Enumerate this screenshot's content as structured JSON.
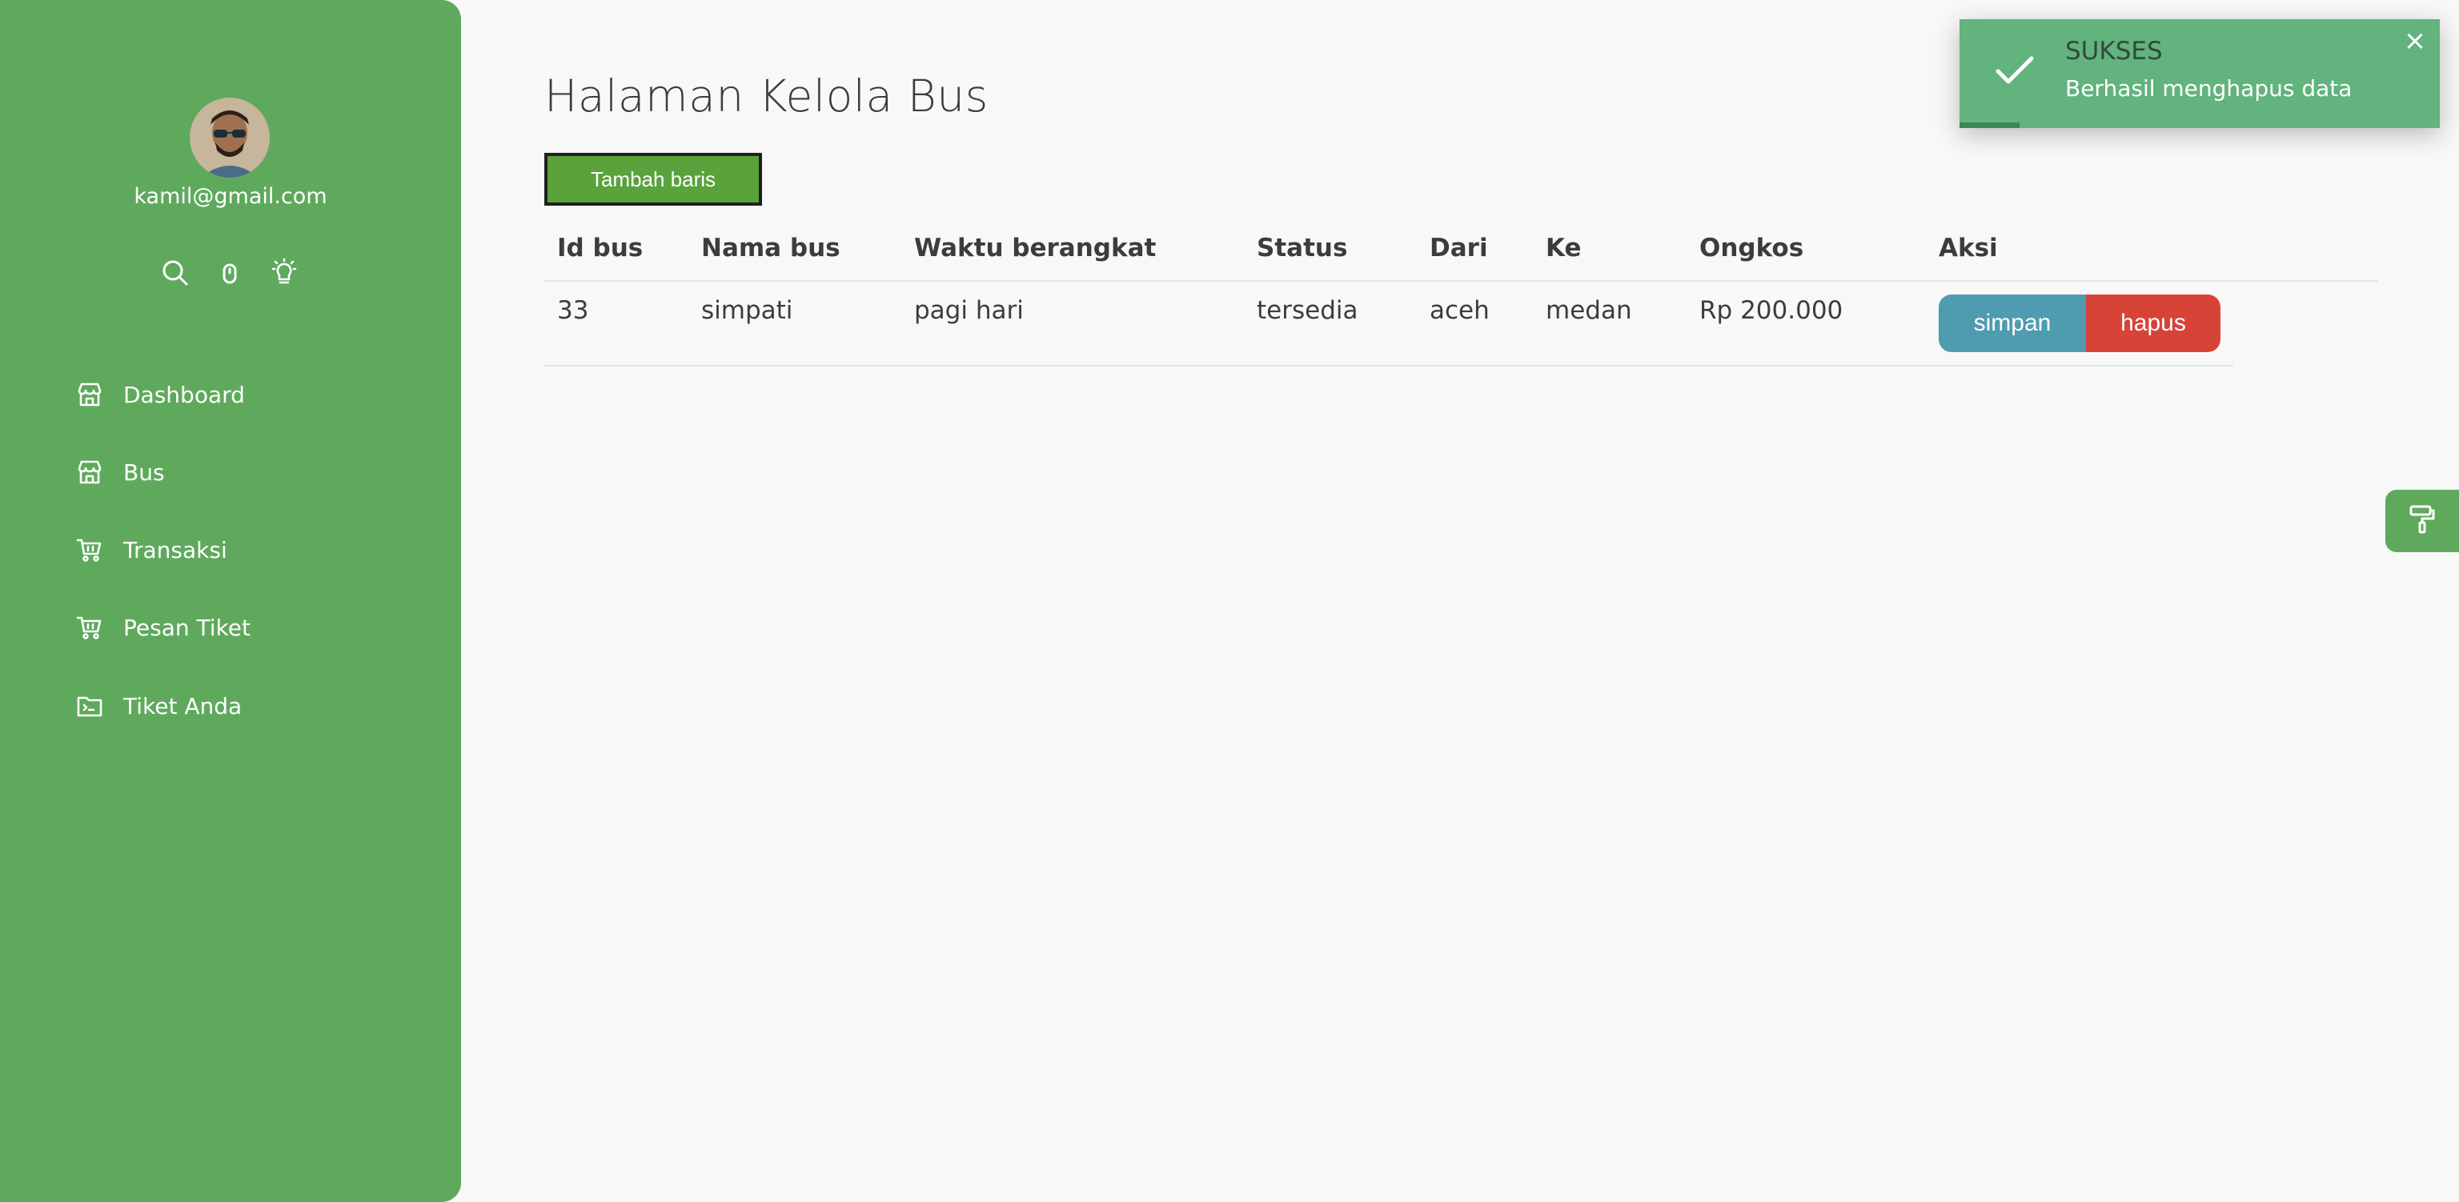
{
  "sidebar": {
    "email": "kamil@gmail.com",
    "icons": [
      "search-icon",
      "user-icon",
      "lightbulb-icon"
    ],
    "items": [
      {
        "label": "Dashboard",
        "icon": "store-icon"
      },
      {
        "label": "Bus",
        "icon": "store-icon"
      },
      {
        "label": "Transaksi",
        "icon": "cart-icon"
      },
      {
        "label": "Pesan Tiket",
        "icon": "cart-icon"
      },
      {
        "label": "Tiket Anda",
        "icon": "folder-icon"
      }
    ]
  },
  "main": {
    "title": "Halaman Kelola Bus",
    "add_row_label": "Tambah baris",
    "table": {
      "headers": [
        "Id bus",
        "Nama bus",
        "Waktu berangkat",
        "Status",
        "Dari",
        "Ke",
        "Ongkos",
        "Aksi"
      ],
      "rows": [
        [
          "33",
          "simpati",
          "pagi hari",
          "tersedia",
          "aceh",
          "medan",
          "Rp 200.000"
        ]
      ],
      "save_label": "simpan",
      "delete_label": "hapus"
    }
  },
  "toast": {
    "title": "SUKSES",
    "message": "Berhasil menghapus data",
    "close_glyph": "×",
    "progress": 0.125
  },
  "colors": {
    "sidebar": "#5fa95d",
    "add_button": "#5aa23c",
    "save_button": "#4f9cb0",
    "delete_button": "#d84338",
    "toast": "#62b37d"
  }
}
